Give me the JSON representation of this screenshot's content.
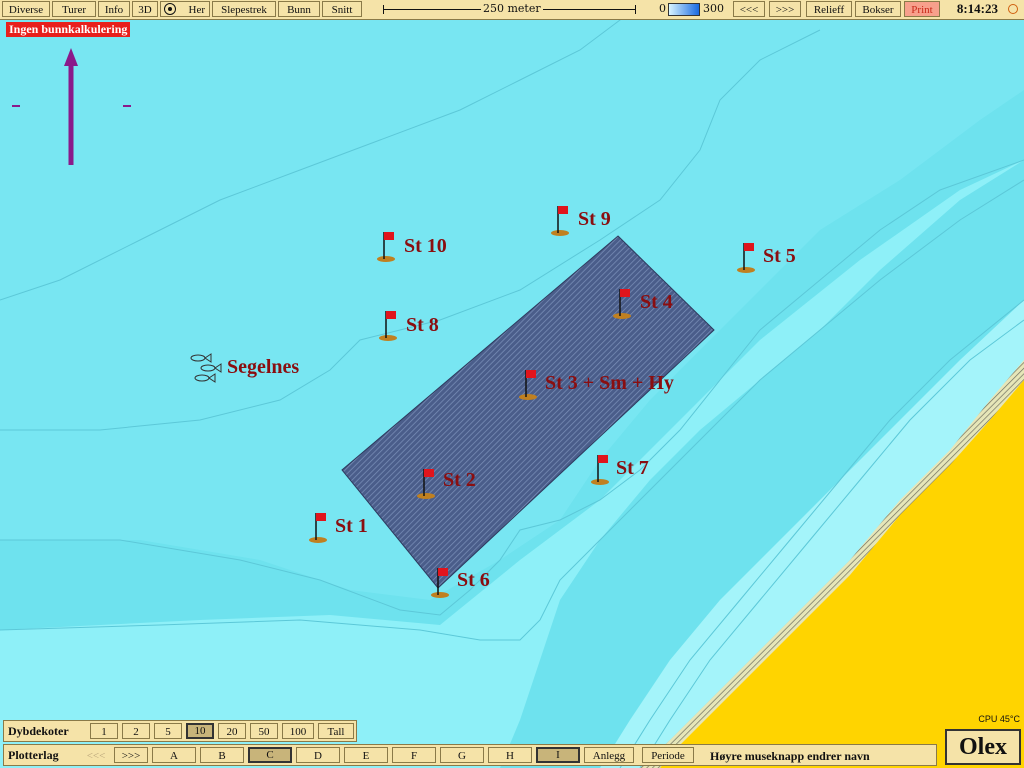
{
  "toolbar": {
    "buttons": [
      "Diverse",
      "Turer",
      "Info",
      "3D",
      "Her",
      "Slepestrek",
      "Bunn",
      "Snitt"
    ],
    "scale_label": "250 meter",
    "depth_min": "0",
    "depth_max": "300",
    "nav_prev": "<<<",
    "nav_next": ">>>",
    "relief": "Relieff",
    "boxes": "Bokser",
    "print": "Print",
    "clock": "8:14:23"
  },
  "warning": "Ingen bunnkalkulering",
  "map": {
    "place_label": "Segelnes",
    "stations": [
      "St 1",
      "St 2",
      "St 3 + Sm + Hy",
      "St 4",
      "St 5",
      "St 6",
      "St 7",
      "St 8",
      "St 9",
      "St 10"
    ]
  },
  "depth_contours": {
    "label": "Dybdekoter",
    "options": [
      "1",
      "2",
      "5",
      "10",
      "20",
      "50",
      "100",
      "Tall"
    ],
    "active": "10"
  },
  "plot_layers": {
    "label": "Plotterlag",
    "prev": "<<<",
    "next": ">>>",
    "layers": [
      "A",
      "B",
      "C",
      "D",
      "E",
      "F",
      "G",
      "H",
      "I"
    ],
    "active_layers": [
      "C",
      "I"
    ],
    "facility": "Anlegg",
    "period": "Periode",
    "hint": "Høyre museknapp endrer navn"
  },
  "cpu": "CPU 45°C",
  "brand": "Olex",
  "colors": {
    "deep_water": "#7ee6f2",
    "mid_water": "#90f0f8",
    "shallow_water": "#a6f4fa",
    "land": "#ffd400",
    "survey_area": "#4a5d8a",
    "station_text": "#8a0e10",
    "flag": "#e0141c",
    "toolbar": "#f5e3a8"
  }
}
